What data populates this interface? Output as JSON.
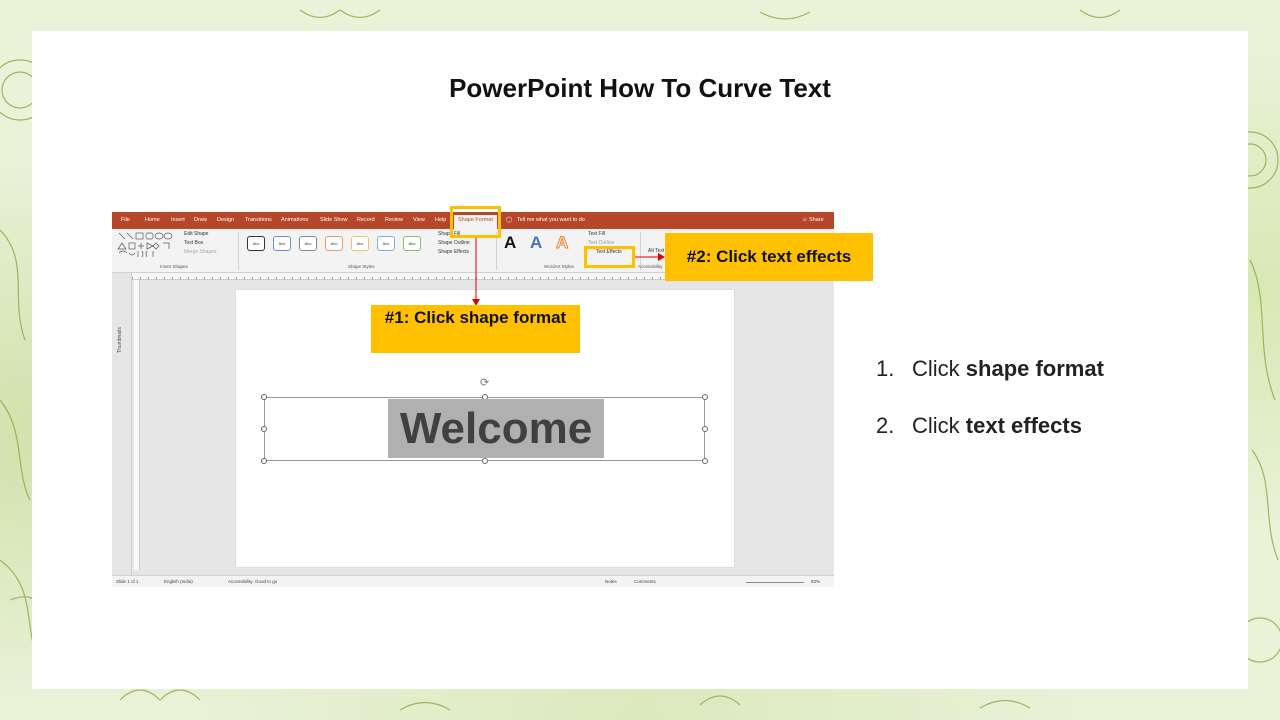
{
  "slide": {
    "title": "PowerPoint How To Curve Text"
  },
  "app": {
    "tabs": [
      "File",
      "Home",
      "Insert",
      "Draw",
      "Design",
      "Transitions",
      "Animations",
      "Slide Show",
      "Record",
      "Review",
      "View",
      "Help",
      "Shape Format"
    ],
    "active_tab": "Shape Format",
    "tell_me": "Tell me what you want to do",
    "share": "Share",
    "ribbon": {
      "insert_shapes_label": "Insert Shapes",
      "edit_shape": "Edit Shape",
      "text_box": "Text Box",
      "merge_shapes": "Merge Shapes",
      "shape_styles_label": "Shape Styles",
      "style_swatch": "Abc",
      "shape_fill": "Shape Fill",
      "shape_outline": "Shape Outline",
      "shape_effects": "Shape Effects",
      "wordart_styles_label": "WordArt Styles",
      "wordart_letter": "A",
      "text_fill": "Text Fill",
      "text_outline": "Text Outline",
      "text_effects": "Text Effects",
      "accessibility_label": "Accessibility",
      "alt_text": "Alt Text"
    },
    "thumbnails_label": "Thumbnails",
    "slide_text": "Welcome",
    "status": {
      "slide": "Slide 1 of 1",
      "language": "English (India)",
      "accessibility": "Accessibility: Good to go",
      "notes": "Notes",
      "comments": "Comments",
      "zoom": "83%"
    }
  },
  "callouts": {
    "one": "#1: Click shape format",
    "two": "#2: Click text effects"
  },
  "steps": [
    {
      "num": "1.",
      "prefix": "Click ",
      "bold": "shape format"
    },
    {
      "num": "2.",
      "prefix": "Click ",
      "bold": "text effects"
    }
  ],
  "colors": {
    "accent": "#ffc000",
    "ppt_red": "#b7472a",
    "arrow": "#e00000"
  }
}
